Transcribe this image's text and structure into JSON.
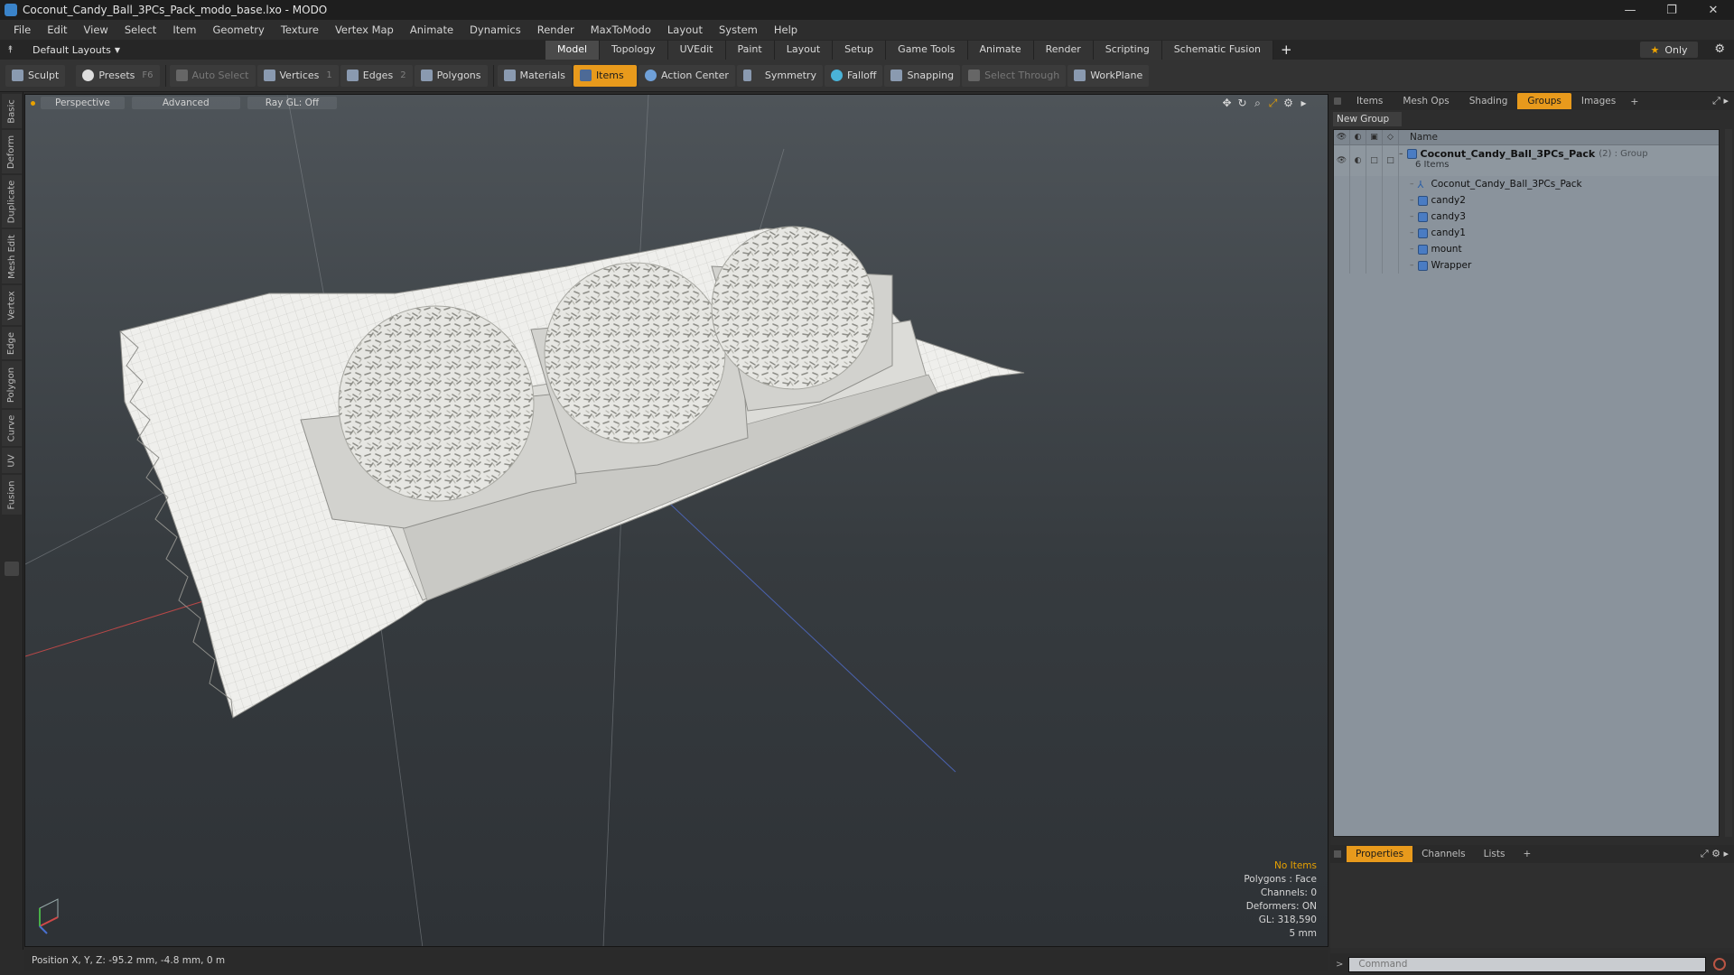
{
  "window": {
    "title": "Coconut_Candy_Ball_3PCs_Pack_modo_base.lxo - MODO",
    "controls": [
      "—",
      "❐",
      "✕"
    ]
  },
  "menu": [
    "File",
    "Edit",
    "View",
    "Select",
    "Item",
    "Geometry",
    "Texture",
    "Vertex Map",
    "Animate",
    "Dynamics",
    "Render",
    "MaxToModo",
    "Layout",
    "System",
    "Help"
  ],
  "layoutbar": {
    "layout_label": "Default Layouts",
    "tabs": [
      "Model",
      "Topology",
      "UVEdit",
      "Paint",
      "Layout",
      "Setup",
      "Game Tools",
      "Animate",
      "Render",
      "Scripting",
      "Schematic Fusion"
    ],
    "active_tab": "Model",
    "only_label": "Only"
  },
  "toolbar": {
    "sculpt": "Sculpt",
    "presets": "Presets",
    "presets_key": "F6",
    "auto_select": "Auto Select",
    "vertices": "Vertices",
    "vertices_key": "1",
    "edges": "Edges",
    "edges_key": "2",
    "polygons": "Polygons",
    "materials": "Materials",
    "items": "Items",
    "action_center": "Action Center",
    "symmetry": "Symmetry",
    "falloff": "Falloff",
    "snapping": "Snapping",
    "select_through": "Select Through",
    "workplane": "WorkPlane"
  },
  "left_tabs": [
    "Basic",
    "Deform",
    "Duplicate",
    "Mesh Edit",
    "Vertex",
    "Edge",
    "Polygon",
    "Curve",
    "UV",
    "Fusion"
  ],
  "viewport": {
    "view": "Perspective",
    "shading": "Advanced",
    "raygl": "Ray GL: Off",
    "info": {
      "selection": "No Items",
      "polygons": "Polygons : Face",
      "channels": "Channels: 0",
      "deformers": "Deformers: ON",
      "gl": "GL: 318,590",
      "scale": "5 mm"
    }
  },
  "statusbar": {
    "position": "Position X, Y, Z:  -95.2 mm, -4.8 mm, 0 m"
  },
  "right_panel": {
    "tabs": [
      "Items",
      "Mesh Ops",
      "Shading",
      "Groups",
      "Images"
    ],
    "active_tab": "Groups",
    "new_group": "New Group",
    "name_header": "Name",
    "group": {
      "name": "Coconut_Candy_Ball_3PCs_Pack",
      "suffix": "(2) : Group",
      "count": "6 Items"
    },
    "items": [
      "Coconut_Candy_Ball_3PCs_Pack",
      "candy2",
      "candy3",
      "candy1",
      "mount",
      "Wrapper"
    ],
    "bottom_tabs": [
      "Properties",
      "Channels",
      "Lists"
    ],
    "bottom_active": "Properties",
    "command_placeholder": "Command"
  },
  "colors": {
    "accent": "#e89a1c",
    "viewport_top": "#4e5459",
    "viewport_bottom": "#2e3236",
    "list_bg": "#8a939c"
  }
}
